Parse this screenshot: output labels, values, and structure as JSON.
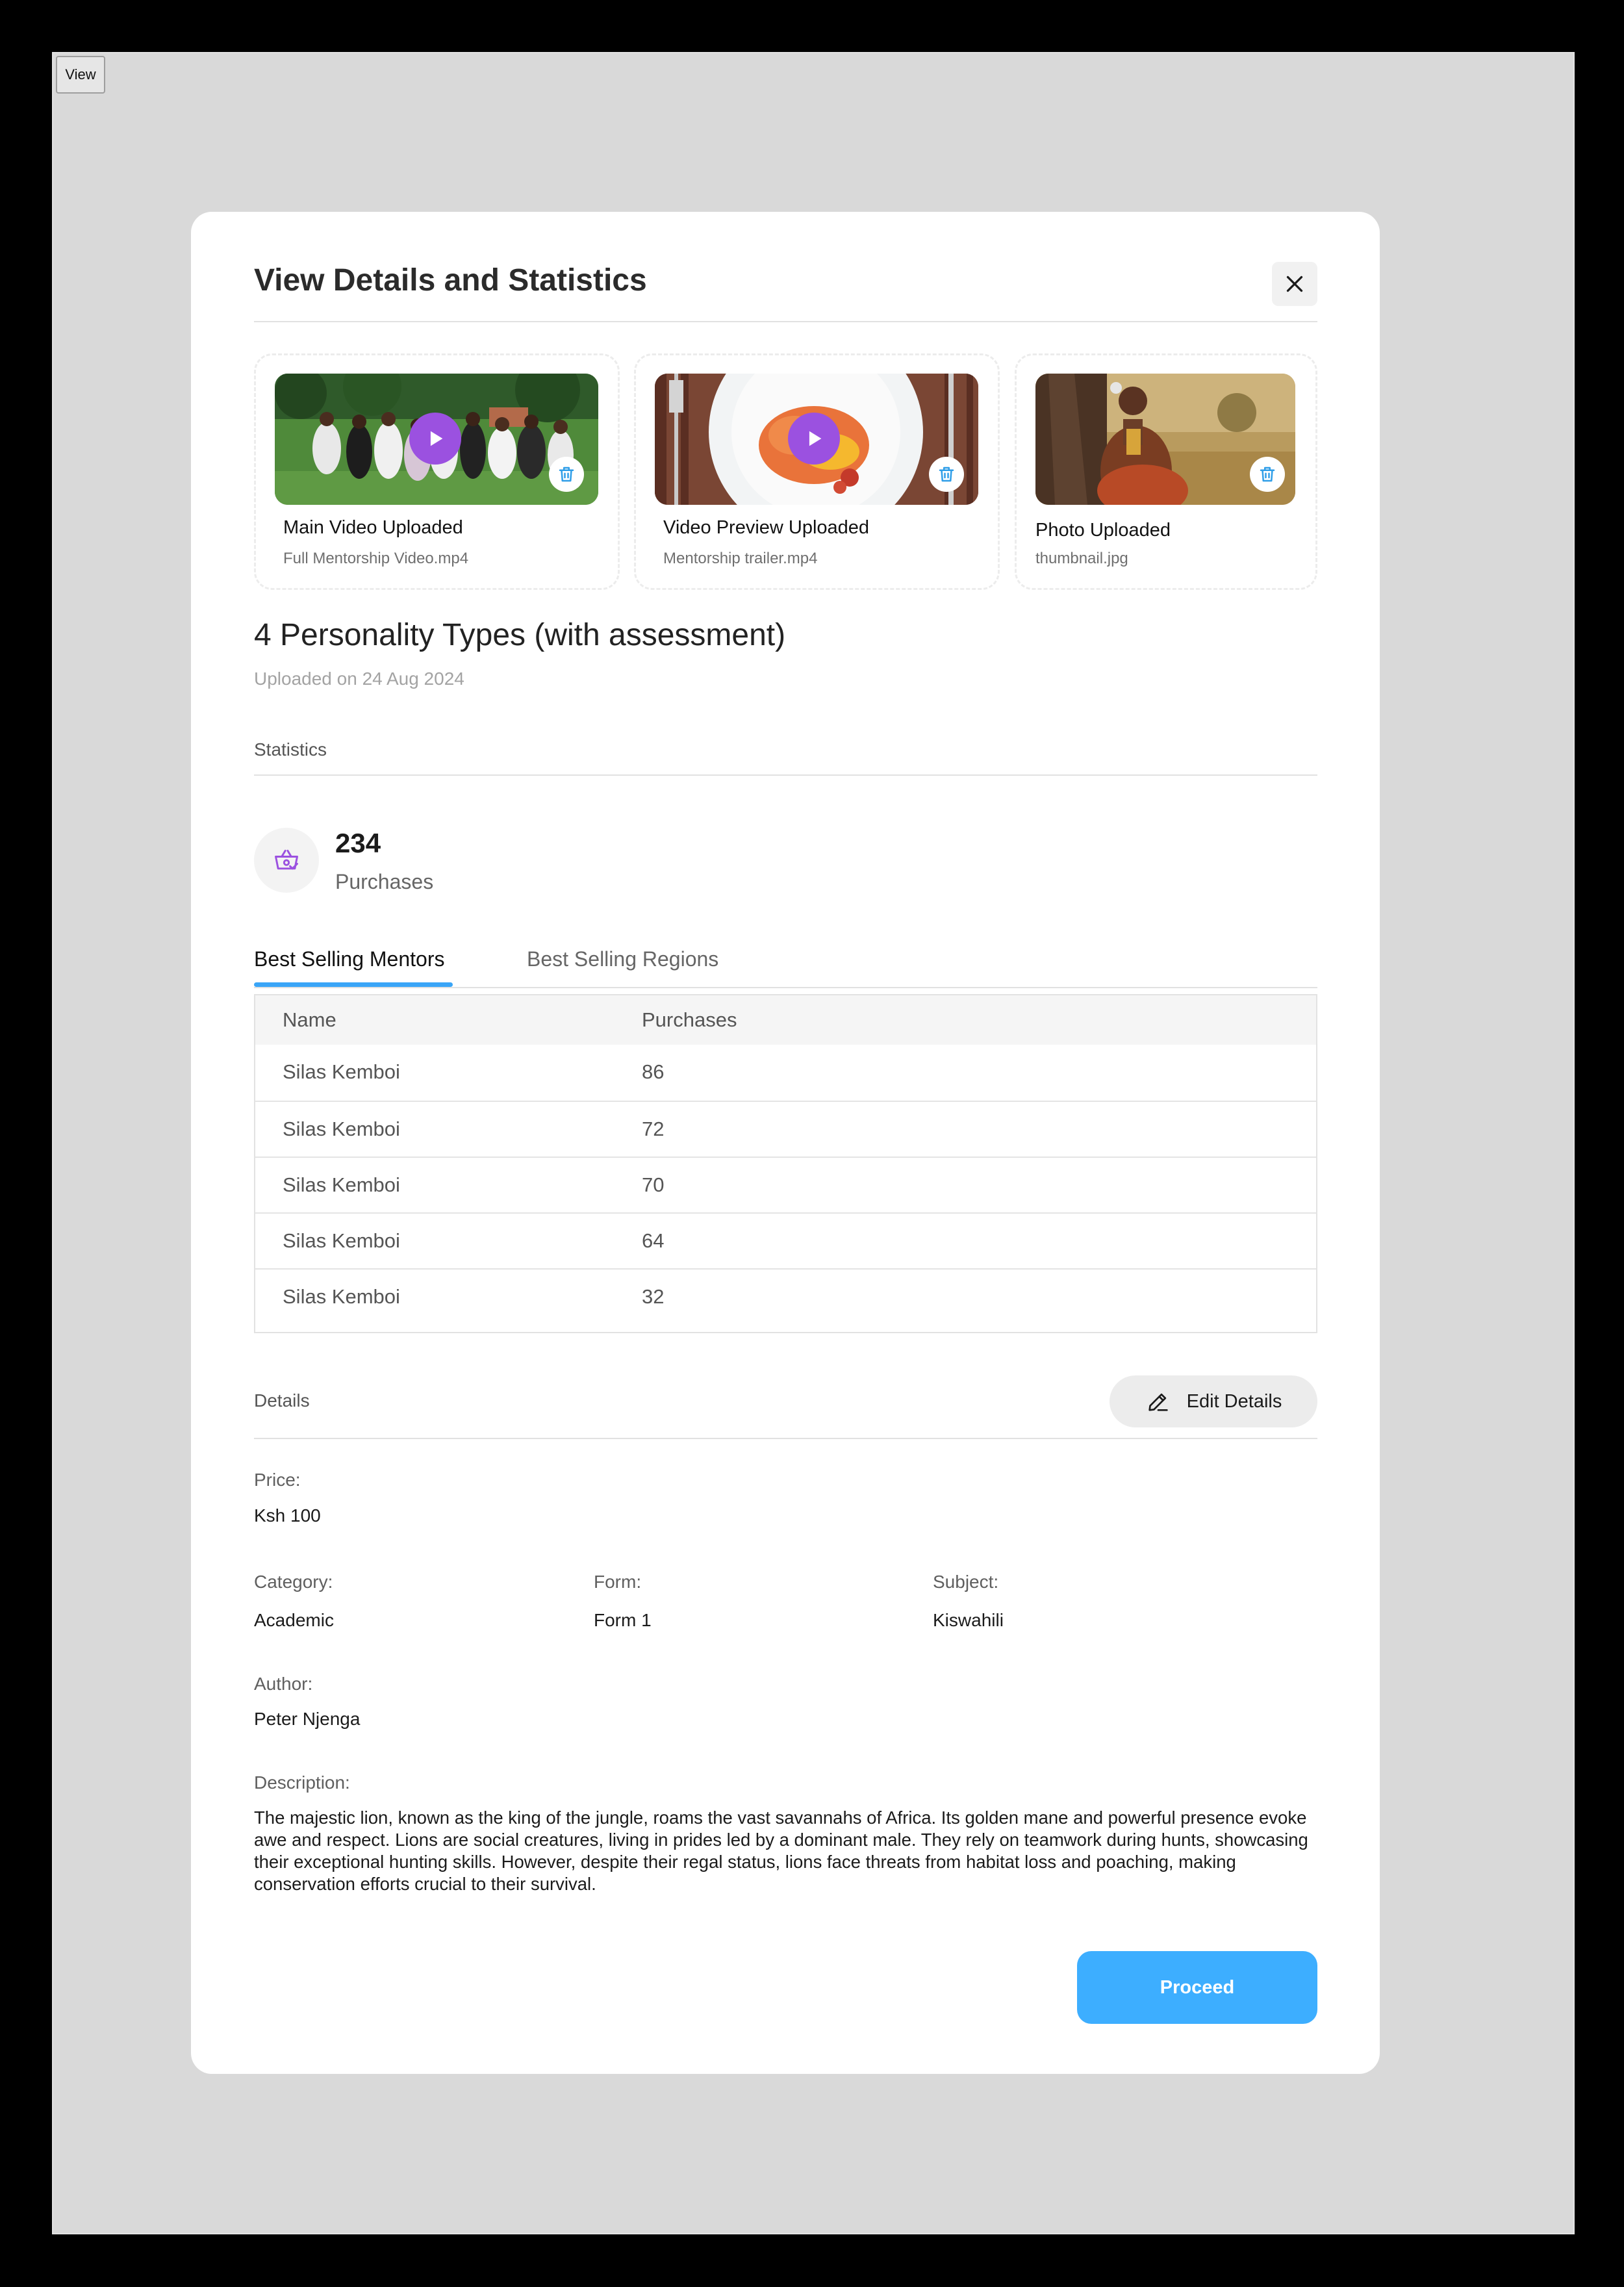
{
  "toolbar": {
    "view_label": "View"
  },
  "modal": {
    "title": "View Details and Statistics",
    "media": [
      {
        "label": "Main Video Uploaded",
        "file": "Full Mentorship Video.mp4"
      },
      {
        "label": "Video Preview Uploaded",
        "file": "Mentorship trailer.mp4"
      },
      {
        "label": "Photo Uploaded",
        "file": "thumbnail.jpg"
      }
    ],
    "item_title": "4 Personality Types (with assessment)",
    "upload_date": "Uploaded on 24 Aug 2024",
    "statistics": {
      "section_label": "Statistics",
      "purchases_value": "234",
      "purchases_label": "Purchases"
    },
    "tabs": [
      {
        "label": "Best Selling Mentors",
        "active": true
      },
      {
        "label": "Best Selling Regions",
        "active": false
      }
    ],
    "table": {
      "headers": [
        "Name",
        "Purchases"
      ],
      "rows": [
        [
          "Silas Kemboi",
          "86"
        ],
        [
          "Silas Kemboi",
          "72"
        ],
        [
          "Silas Kemboi",
          "70"
        ],
        [
          "Silas Kemboi",
          "64"
        ],
        [
          "Silas Kemboi",
          "32"
        ]
      ]
    },
    "details": {
      "section_label": "Details",
      "edit_label": "Edit Details",
      "price_label": "Price:",
      "price_value": "Ksh 100",
      "category_label": "Category:",
      "category_value": "Academic",
      "form_label": "Form:",
      "form_value": "Form 1",
      "subject_label": "Subject:",
      "subject_value": "Kiswahili",
      "author_label": "Author:",
      "author_value": "Peter Njenga",
      "description_label": "Description:",
      "description_value": "The majestic lion, known as the king of the jungle, roams the vast savannahs of Africa. Its golden mane and powerful presence evoke awe and respect. Lions are social creatures, living in prides led by a dominant male. They rely on teamwork during hunts, showcasing their exceptional hunting skills. However, despite their regal status, lions face threats from habitat loss and poaching, making conservation efforts crucial to their survival."
    },
    "proceed_label": "Proceed"
  },
  "colors": {
    "accent": "#3daeff",
    "play": "#9b51e0",
    "tab_underline": "#3aa5f7",
    "icon_purple": "#9b51e0"
  },
  "icons": [
    "close-icon",
    "play-icon",
    "trash-icon",
    "shopping-basket-icon",
    "pencil-icon"
  ]
}
